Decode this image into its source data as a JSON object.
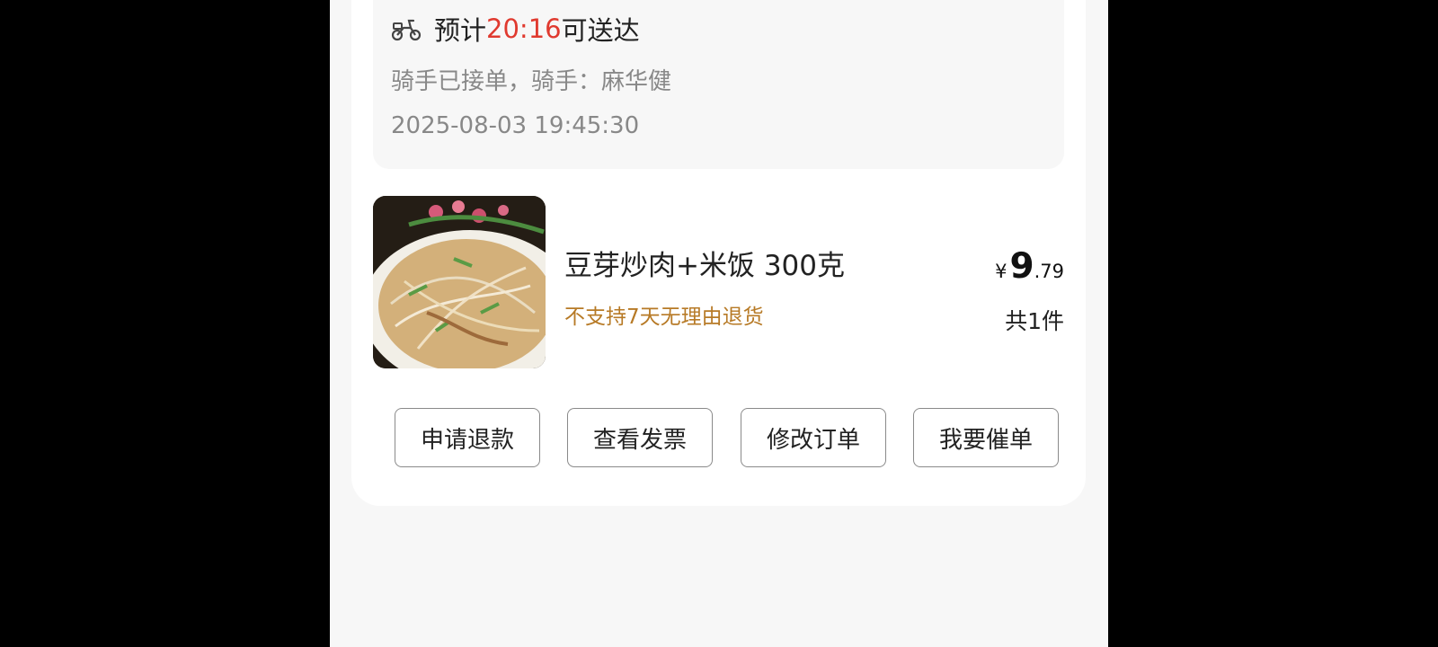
{
  "delivery": {
    "eta_prefix": "预计",
    "eta_time": "20:16",
    "eta_suffix": "可送达",
    "rider_status": "骑手已接单，骑手：麻华健",
    "timestamp": "2025-08-03 19:45:30",
    "icon": "scooter-icon",
    "accent_color": "#e03a2f"
  },
  "item": {
    "name": "豆芽炒肉+米饭 300克",
    "return_policy": "不支持7天无理由退货",
    "price_currency": "¥",
    "price_integer": "9",
    "price_decimal": ".79",
    "quantity": "共1件"
  },
  "actions": {
    "refund_label": "申请退款",
    "invoice_label": "查看发票",
    "modify_label": "修改订单",
    "urge_label": "我要催单"
  }
}
